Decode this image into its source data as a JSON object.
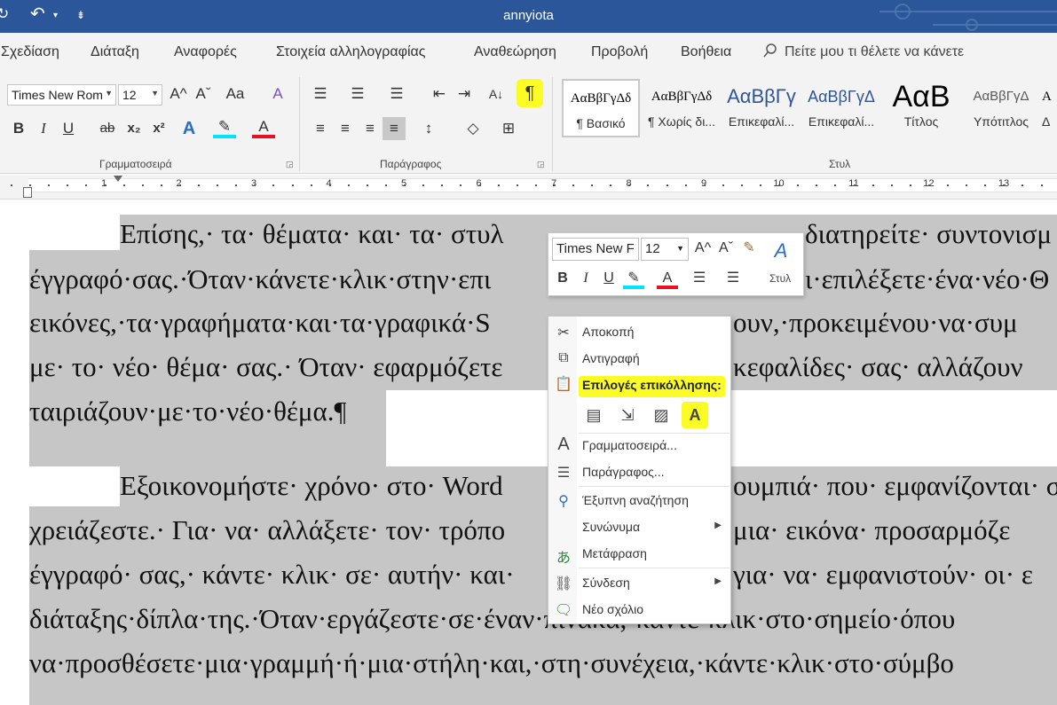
{
  "window": {
    "title": "annyiota"
  },
  "quick_access": {
    "redo_glyph": "↻",
    "undo_glyph": "↶",
    "undo_arrow": "▾",
    "customize_glyph": "⇟"
  },
  "tabs": [
    "Σχεδίαση",
    "Διάταξη",
    "Αναφορές",
    "Στοιχεία αλληλογραφίας",
    "Αναθεώρηση",
    "Προβολή",
    "Βοήθεια"
  ],
  "tell_me": {
    "icon": "search-icon",
    "text": "Πείτε μου τι θέλετε να κάνετε"
  },
  "ribbon": {
    "font_name": "Times New Rom",
    "font_size": "12",
    "font_group_label": "Γραμματοσειρά",
    "paragraph_group_label": "Παράγραφος",
    "styles_group_label": "Στυλ",
    "buttons": {
      "grow": "A^",
      "shrink": "Aˇ",
      "change_case": "Aa",
      "clear_format": "A",
      "bold": "B",
      "italic": "I",
      "underline": "U",
      "strike": "ab",
      "subscript": "x₂",
      "superscript": "x²",
      "text_effects": "A",
      "highlight": "✎",
      "font_color": "A",
      "bullets": "☰",
      "numbering": "☰",
      "multilevel": "☰",
      "decrease_indent": "⇤",
      "increase_indent": "⇥",
      "sort": "A↓",
      "show_marks": "¶",
      "align_left": "≡",
      "align_center": "≡",
      "align_right": "≡",
      "justify": "≡",
      "line_spacing": "↕",
      "shading": "◇",
      "borders": "⊞"
    },
    "styles": [
      {
        "preview": "ΑαΒβΓγΔδ",
        "name": "¶ Βασικό"
      },
      {
        "preview": "ΑαΒβΓγΔδ",
        "name": "¶ Χωρίς δι..."
      },
      {
        "preview": "ΑαΒβΓγ",
        "name": "Επικεφαλί..."
      },
      {
        "preview": "ΑαΒβΓγΔ",
        "name": "Επικεφαλί..."
      },
      {
        "preview": "ΑαΒ",
        "name": "Τίτλος"
      },
      {
        "preview": "ΑαΒβΓγΔ",
        "name": "Υπότιτλος"
      },
      {
        "preview": "Α",
        "name": "Δ"
      }
    ]
  },
  "ruler": {
    "numbers": [
      "1",
      "2",
      "3",
      "4",
      "5",
      "6",
      "7",
      "8",
      "9",
      "10",
      "11",
      "12",
      "13"
    ]
  },
  "document": {
    "lines": [
      "Επίσης,· τα· θέματα· και· τα· στυλ",
      "διατηρείτε· συντονισμ",
      "έγγραφό·σας.·Όταν·κάνετε·κλικ·στην·επι",
      "ι·επιλέξετε·ένα·νέο·Θ",
      "εικόνες,·τα·γραφήματα·και·τα·γραφικά·S",
      "ουν,·προκειμένου·να·συμ",
      "με· το· νέο· θέμα· σας.· Όταν· εφαρμόζετε",
      "κεφαλίδες· σας· αλλάζουν",
      "ταιριάζουν·με·το·νέο·θέμα.¶",
      "Εξοικονομήστε· χρόνο· στο· Word",
      "ουμπιά· που· εμφανίζονται· σ",
      "χρειάζεστε.· Για· να· αλλάξετε· τον· τρόπο",
      "μια· εικόνα· προσαρμόζε",
      "έγγραφό· σας,· κάντε· κλικ· σε· αυτήν· και·",
      "για· να· εμφανιστούν· οι· ε",
      "διάταξης·δίπλα·της.·Όταν·εργάζεστε·σε·έναν·πίνακα,·κάντε·κλικ·στο·σημείο·όπου",
      "να·προσθέσετε·μια·γραμμή·ή·μια·στήλη·και,·στη·συνέχεια,·κάντε·κλικ·στο·σύμβο"
    ]
  },
  "mini_toolbar": {
    "font_name": "Times New F",
    "font_size": "12",
    "styles_label": "Στυλ",
    "buttons": {
      "grow": "A^",
      "shrink": "Aˇ",
      "format_painter": "✎",
      "bold": "B",
      "italic": "I",
      "underline": "U",
      "highlight": "✎",
      "font_color": "A",
      "bullets": "☰",
      "numbering": "☰",
      "styles": "A"
    }
  },
  "context_menu": {
    "cut": "Αποκοπή",
    "copy": "Αντιγραφή",
    "paste_options": "Επιλογές επικόλλησης:",
    "font": "Γραμματοσειρά...",
    "paragraph": "Παράγραφος...",
    "smart_lookup": "Έξυπνη αναζήτηση",
    "synonyms": "Συνώνυμα",
    "translate": "Μετάφραση",
    "link": "Σύνδεση",
    "new_comment": "Νέο σχόλιο",
    "submenu_arrow": "▶"
  },
  "colors": {
    "title_bar": "#2b579a",
    "highlight_yellow": "#fbfb26",
    "selection_gray": "#c6c6c6",
    "font_color_red": "#e81123",
    "highlight_cyan": "#00e5ff"
  }
}
